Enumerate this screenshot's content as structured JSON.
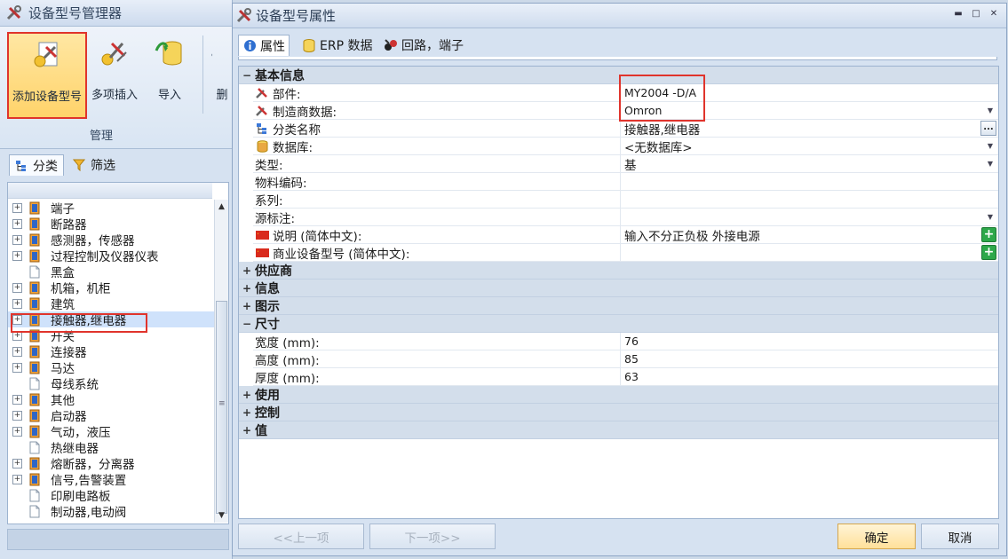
{
  "left_window": {
    "title": "设备型号管理器",
    "ribbon": {
      "add_label": "添加设备型号",
      "multi_insert_label": "多项插入",
      "import_label": "导入",
      "delete_label_cut": "删",
      "group_label": "管理"
    },
    "tabs": {
      "category": "分类",
      "filter": "筛选"
    },
    "tree": [
      {
        "label": "端子",
        "expandable": true,
        "icon": "book-icon"
      },
      {
        "label": "断路器",
        "expandable": true,
        "icon": "book-icon"
      },
      {
        "label": "感测器，传感器",
        "expandable": true,
        "icon": "book-icon"
      },
      {
        "label": "过程控制及仪器仪表",
        "expandable": true,
        "icon": "book-icon"
      },
      {
        "label": "黑盒",
        "expandable": false,
        "icon": "page-icon"
      },
      {
        "label": "机箱，机柜",
        "expandable": true,
        "icon": "book-icon"
      },
      {
        "label": "建筑",
        "expandable": true,
        "icon": "book-icon"
      },
      {
        "label": "接触器,继电器",
        "expandable": true,
        "icon": "book-icon",
        "selected": true
      },
      {
        "label": "开关",
        "expandable": true,
        "icon": "book-icon"
      },
      {
        "label": "连接器",
        "expandable": true,
        "icon": "book-icon"
      },
      {
        "label": "马达",
        "expandable": true,
        "icon": "book-icon"
      },
      {
        "label": "母线系统",
        "expandable": false,
        "icon": "page-icon"
      },
      {
        "label": "其他",
        "expandable": true,
        "icon": "book-icon"
      },
      {
        "label": "启动器",
        "expandable": true,
        "icon": "book-icon"
      },
      {
        "label": "气动，液压",
        "expandable": true,
        "icon": "book-icon"
      },
      {
        "label": "热继电器",
        "expandable": false,
        "icon": "page-icon"
      },
      {
        "label": "熔断器，分离器",
        "expandable": true,
        "icon": "book-icon"
      },
      {
        "label": "信号,告警装置",
        "expandable": true,
        "icon": "book-icon"
      },
      {
        "label": "印刷电路板",
        "expandable": false,
        "icon": "page-icon"
      },
      {
        "label": "制动器,电动阀",
        "expandable": false,
        "icon": "page-icon"
      }
    ]
  },
  "right_window": {
    "title": "设备型号属性",
    "tabs": {
      "properties": "属性",
      "erp": "ERP 数据",
      "circuit": "回路，端子"
    },
    "grid": {
      "basic_info": {
        "label": "基本信息",
        "rows": {
          "part": {
            "name": "部件:",
            "value": "MY2004 -D/A"
          },
          "manufacturer": {
            "name": "制造商数据:",
            "value": "Omron"
          },
          "category": {
            "name": "分类名称",
            "value": "接触器,继电器"
          },
          "database": {
            "name": "数据库:",
            "value": "<无数据库>"
          },
          "type": {
            "name": "类型:",
            "value": "基"
          },
          "material_code": {
            "name": "物料编码:",
            "value": ""
          },
          "series": {
            "name": "系列:",
            "value": ""
          },
          "source_marking": {
            "name": "源标注:",
            "value": ""
          },
          "description": {
            "name": "说明 (简体中文):",
            "value": "输入不分正负极 外接电源"
          },
          "commercial_type": {
            "name": "商业设备型号 (简体中文):",
            "value": ""
          }
        }
      },
      "supplier": {
        "label": "供应商"
      },
      "info": {
        "label": "信息"
      },
      "graphics": {
        "label": "图示"
      },
      "dimensions": {
        "label": "尺寸",
        "rows": {
          "width": {
            "name": "宽度 (mm):",
            "value": "76"
          },
          "height": {
            "name": "高度 (mm):",
            "value": "85"
          },
          "depth": {
            "name": "厚度 (mm):",
            "value": "63"
          }
        }
      },
      "usage": {
        "label": "使用"
      },
      "control": {
        "label": "控制"
      },
      "value": {
        "label": "值"
      }
    },
    "footer": {
      "prev": "<<上一项",
      "next": "下一项>>",
      "ok": "确定",
      "cancel": "取消"
    }
  }
}
